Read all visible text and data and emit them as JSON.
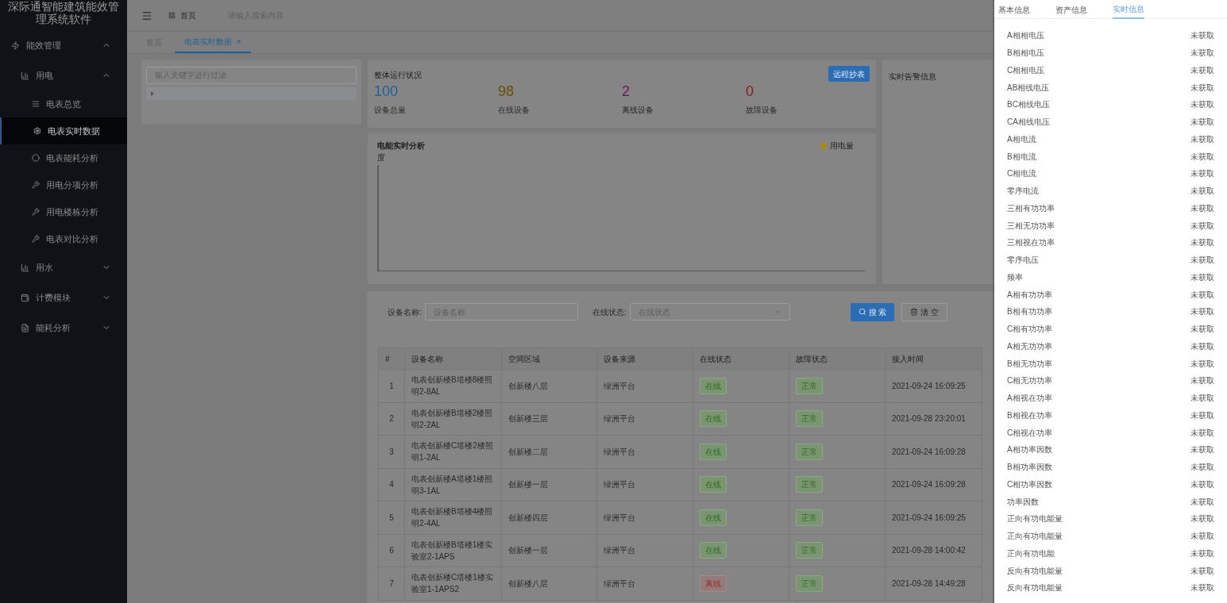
{
  "sidebar": {
    "title": "深际通智能建筑能效管理系统软件",
    "menu": [
      {
        "label": "能效管理",
        "kind": "bolt",
        "expanded": true,
        "children": [
          {
            "label": "用电",
            "kind": "chart",
            "expanded": true,
            "children": [
              {
                "label": "电表总览",
                "kind": "list",
                "selected": false
              },
              {
                "label": "电表实时数据",
                "kind": "gear",
                "selected": true
              },
              {
                "label": "电表能耗分析",
                "kind": "circle",
                "selected": false
              },
              {
                "label": "用电分项分析",
                "kind": "wrench",
                "selected": false
              },
              {
                "label": "用电楼栋分析",
                "kind": "wrench",
                "selected": false
              },
              {
                "label": "电表对比分析",
                "kind": "wrench",
                "selected": false
              }
            ]
          },
          {
            "label": "用水",
            "kind": "chart",
            "expanded": false
          },
          {
            "label": "计费模块",
            "kind": "wallet",
            "expanded": false
          },
          {
            "label": "能耗分析",
            "kind": "doc",
            "expanded": false
          }
        ]
      }
    ]
  },
  "header": {
    "home": "首页",
    "search_placeholder": "请输入搜索内容"
  },
  "tabs": [
    {
      "label": "首页",
      "selected": false
    },
    {
      "label": "电表实时数据",
      "selected": true,
      "close": "×"
    }
  ],
  "tree": {
    "filter_placeholder": "输入关键字进行过滤"
  },
  "status_card": {
    "title": "整体运行状况",
    "button": "远程抄表",
    "stats": [
      {
        "value": "100",
        "label": "设备总量",
        "color": "#1f5f99"
      },
      {
        "value": "98",
        "label": "在线设备",
        "color": "#6b4f00"
      },
      {
        "value": "2",
        "label": "离线设备",
        "color": "#6a1a5a"
      },
      {
        "value": "0",
        "label": "故障设备",
        "color": "#8a2020"
      }
    ]
  },
  "chart_card": {
    "title": "电能实时分析",
    "unit": "度",
    "legend": {
      "label": "用电量",
      "color": "#a88a10"
    }
  },
  "alert_card": {
    "title": "实时告警信息"
  },
  "filter": {
    "name_label": "设备名称:",
    "name_placeholder": "设备名称",
    "status_label": "在线状态:",
    "status_placeholder": "在线状态",
    "search_button": "搜 索",
    "clear_button": "清 空"
  },
  "table": {
    "columns": [
      "#",
      "设备名称",
      "空间区域",
      "设备来源",
      "在线状态",
      "故障状态",
      "接入时间"
    ],
    "rows": [
      {
        "index": "1",
        "name": "电表创新楼B塔楼8楼照明2-8AL",
        "area": "创新楼八层",
        "source": "绿洲平台",
        "online": {
          "text": "在线",
          "kind": "ok"
        },
        "fault": {
          "text": "正常",
          "kind": "ok"
        },
        "time": "2021-09-24 16:09:25"
      },
      {
        "index": "2",
        "name": "电表创新楼B塔楼2楼照明2-2AL",
        "area": "创新楼三层",
        "source": "绿洲平台",
        "online": {
          "text": "在线",
          "kind": "ok"
        },
        "fault": {
          "text": "正常",
          "kind": "ok"
        },
        "time": "2021-09-28 23:20:01"
      },
      {
        "index": "3",
        "name": "电表创新楼C塔楼2楼照明1-2AL",
        "area": "创新楼二层",
        "source": "绿洲平台",
        "online": {
          "text": "在线",
          "kind": "ok"
        },
        "fault": {
          "text": "正常",
          "kind": "ok"
        },
        "time": "2021-09-24 16:09:28"
      },
      {
        "index": "4",
        "name": "电表创新楼A塔楼1楼照明3-1AL",
        "area": "创新楼一层",
        "source": "绿洲平台",
        "online": {
          "text": "在线",
          "kind": "ok"
        },
        "fault": {
          "text": "正常",
          "kind": "ok"
        },
        "time": "2021-09-24 16:09:28"
      },
      {
        "index": "5",
        "name": "电表创新楼B塔楼4楼照明2-4AL",
        "area": "创新楼四层",
        "source": "绿洲平台",
        "online": {
          "text": "在线",
          "kind": "ok"
        },
        "fault": {
          "text": "正常",
          "kind": "ok"
        },
        "time": "2021-09-24 16:09:25"
      },
      {
        "index": "6",
        "name": "电表创新楼B塔楼1楼实验室2-1APS",
        "area": "创新楼一层",
        "source": "绿洲平台",
        "online": {
          "text": "在线",
          "kind": "ok"
        },
        "fault": {
          "text": "正常",
          "kind": "ok"
        },
        "time": "2021-09-28 14:00:42"
      },
      {
        "index": "7",
        "name": "电表创新楼C塔楼1楼实验室1-1APS2",
        "area": "创新楼八层",
        "source": "绿洲平台",
        "online": {
          "text": "离线",
          "kind": "bad"
        },
        "fault": {
          "text": "正常",
          "kind": "ok"
        },
        "time": "2021-09-28 14:49:28"
      }
    ]
  },
  "drawer": {
    "tabs": [
      {
        "label": "基本信息",
        "selected": false
      },
      {
        "label": "资产信息",
        "selected": false
      },
      {
        "label": "实时信息",
        "selected": true
      }
    ],
    "rows": [
      {
        "label": "A相相电压",
        "value": "未获取"
      },
      {
        "label": "B相相电压",
        "value": "未获取"
      },
      {
        "label": "C相相电压",
        "value": "未获取"
      },
      {
        "label": "AB相线电压",
        "value": "未获取"
      },
      {
        "label": "BC相线电压",
        "value": "未获取"
      },
      {
        "label": "CA相线电压",
        "value": "未获取"
      },
      {
        "label": "A相电流",
        "value": "未获取"
      },
      {
        "label": "B相电流",
        "value": "未获取"
      },
      {
        "label": "C相电流",
        "value": "未获取"
      },
      {
        "label": "零序电流",
        "value": "未获取"
      },
      {
        "label": "三相有功功率",
        "value": "未获取"
      },
      {
        "label": "三相无功功率",
        "value": "未获取"
      },
      {
        "label": "三相视在功率",
        "value": "未获取"
      },
      {
        "label": "零序电压",
        "value": "未获取"
      },
      {
        "label": "频率",
        "value": "未获取"
      },
      {
        "label": "A相有功功率",
        "value": "未获取"
      },
      {
        "label": "B相有功功率",
        "value": "未获取"
      },
      {
        "label": "C相有功功率",
        "value": "未获取"
      },
      {
        "label": "A相无功功率",
        "value": "未获取"
      },
      {
        "label": "B相无功功率",
        "value": "未获取"
      },
      {
        "label": "C相无功功率",
        "value": "未获取"
      },
      {
        "label": "A相视在功率",
        "value": "未获取"
      },
      {
        "label": "B相视在功率",
        "value": "未获取"
      },
      {
        "label": "C相视在功率",
        "value": "未获取"
      },
      {
        "label": "A相功率因数",
        "value": "未获取"
      },
      {
        "label": "B相功率因数",
        "value": "未获取"
      },
      {
        "label": "C相功率因数",
        "value": "未获取"
      },
      {
        "label": "功率因数",
        "value": "未获取"
      },
      {
        "label": "正向有功电能量",
        "value": "未获取"
      },
      {
        "label": "正向有功电能量",
        "value": "未获取"
      },
      {
        "label": "正向有功电能",
        "value": "未获取"
      },
      {
        "label": "反向有功电能量",
        "value": "未获取"
      },
      {
        "label": "反向有功电能量",
        "value": "未获取"
      }
    ]
  }
}
